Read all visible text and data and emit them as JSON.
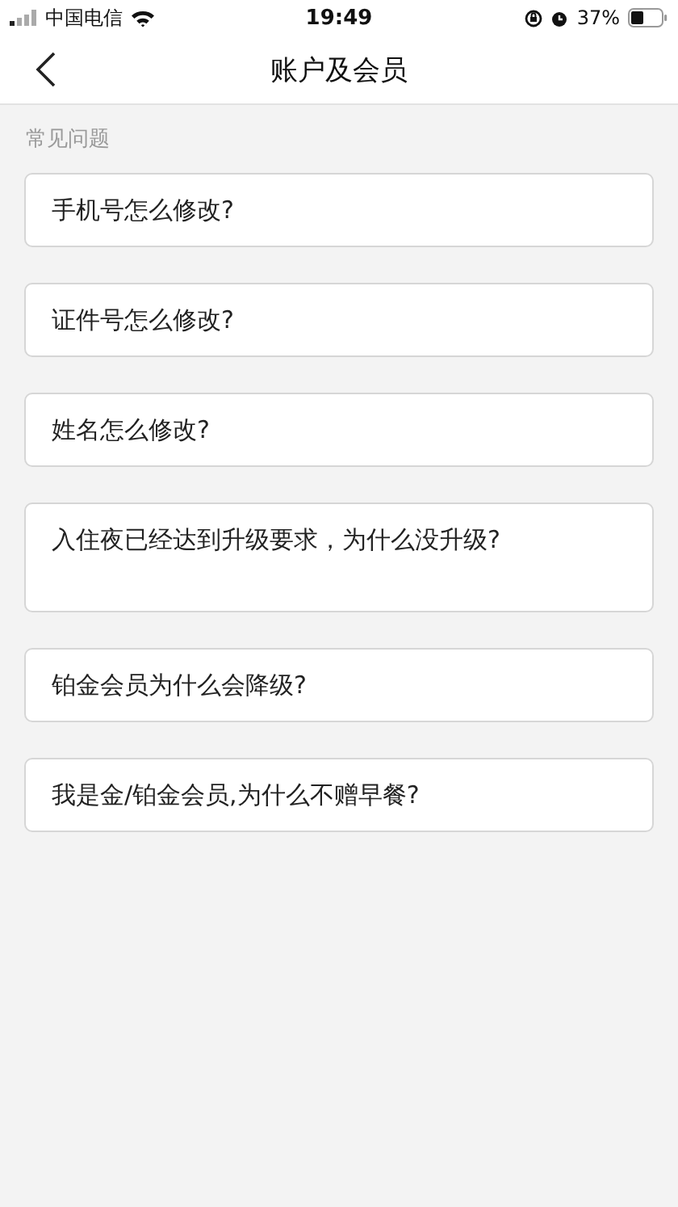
{
  "status_bar": {
    "carrier": "中国电信",
    "time": "19:49",
    "battery": "37%"
  },
  "nav": {
    "title": "账户及会员"
  },
  "section": {
    "title": "常见问题"
  },
  "questions": [
    {
      "text": "手机号怎么修改?",
      "kind": "short"
    },
    {
      "text": "证件号怎么修改?",
      "kind": "short"
    },
    {
      "text": "姓名怎么修改?",
      "kind": "short"
    },
    {
      "text": "入住夜已经达到升级要求，为什么没升级?",
      "kind": "tall"
    },
    {
      "text": "铂金会员为什么会降级?",
      "kind": "short"
    },
    {
      "text": "我是金/铂金会员,为什么不赠早餐?",
      "kind": "short"
    }
  ]
}
